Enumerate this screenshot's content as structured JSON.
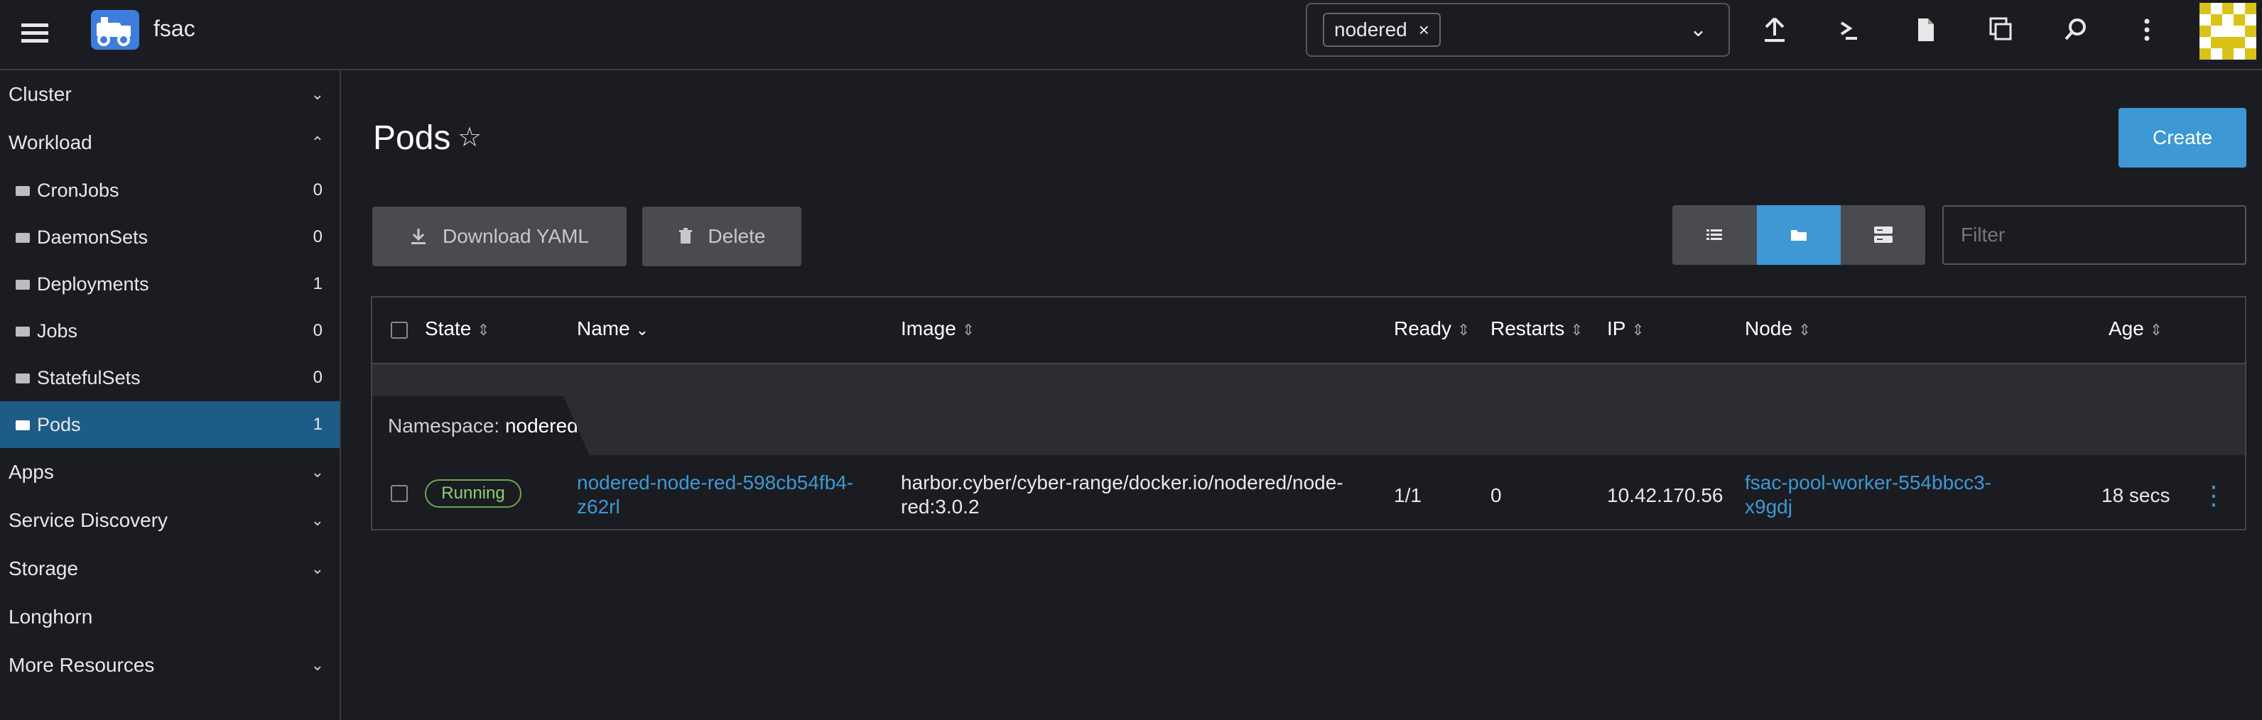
{
  "header": {
    "app_title": "fsac",
    "namespace_chip": "nodered",
    "namespace_chip_close": "×",
    "namespace_dropdown_chevron": "⌄",
    "icons": [
      "upload-icon",
      "terminal-icon",
      "file-icon",
      "copy-icon",
      "search-icon",
      "more-vert-icon",
      "avatar"
    ]
  },
  "sidebar": {
    "groups_top": [
      {
        "label": "Cluster",
        "chevron": "⌄"
      },
      {
        "label": "Workload",
        "chevron": "⌃"
      }
    ],
    "workload_items": [
      {
        "label": "CronJobs",
        "count": "0"
      },
      {
        "label": "DaemonSets",
        "count": "0"
      },
      {
        "label": "Deployments",
        "count": "1"
      },
      {
        "label": "Jobs",
        "count": "0"
      },
      {
        "label": "StatefulSets",
        "count": "0"
      },
      {
        "label": "Pods",
        "count": "1"
      }
    ],
    "groups_bottom": [
      {
        "label": "Apps",
        "chevron": "⌄"
      },
      {
        "label": "Service Discovery",
        "chevron": "⌄"
      },
      {
        "label": "Storage",
        "chevron": "⌄"
      },
      {
        "label": "Longhorn",
        "chevron": ""
      },
      {
        "label": "More Resources",
        "chevron": "⌄"
      }
    ]
  },
  "main": {
    "title": "Pods",
    "favorite_star": "☆",
    "create_label": "Create",
    "download_yaml_label": "Download YAML",
    "delete_label": "Delete",
    "filter_placeholder": "Filter",
    "view_modes": [
      "list-view-icon",
      "group-by-namespace-icon",
      "group-by-node-icon"
    ],
    "active_view": "group-by-namespace-icon"
  },
  "table": {
    "columns": {
      "state": "State",
      "name": "Name",
      "image": "Image",
      "ready": "Ready",
      "restarts": "Restarts",
      "ip": "IP",
      "node": "Node",
      "age": "Age"
    },
    "group_label": "Namespace:",
    "group_value": "nodered",
    "rows": [
      {
        "state": "Running",
        "name_line1": "nodered-node-red-598cb54fb4-",
        "name_line2": "z62rl",
        "image_line1": "harbor.cyber/cyber-range/docker.io/nodered/node-",
        "image_line2": "red:3.0.2",
        "ready": "1/1",
        "restarts": "0",
        "ip": "10.42.170.56",
        "node_line1": "fsac-pool-worker-554bbcc3-",
        "node_line2": "x9gdj",
        "age": "18 secs"
      }
    ]
  },
  "colors": {
    "background": "#1b1c21",
    "accent": "#3d98d3",
    "active_sidebar": "#1d5c86",
    "running_badge": "#6aa84f"
  }
}
